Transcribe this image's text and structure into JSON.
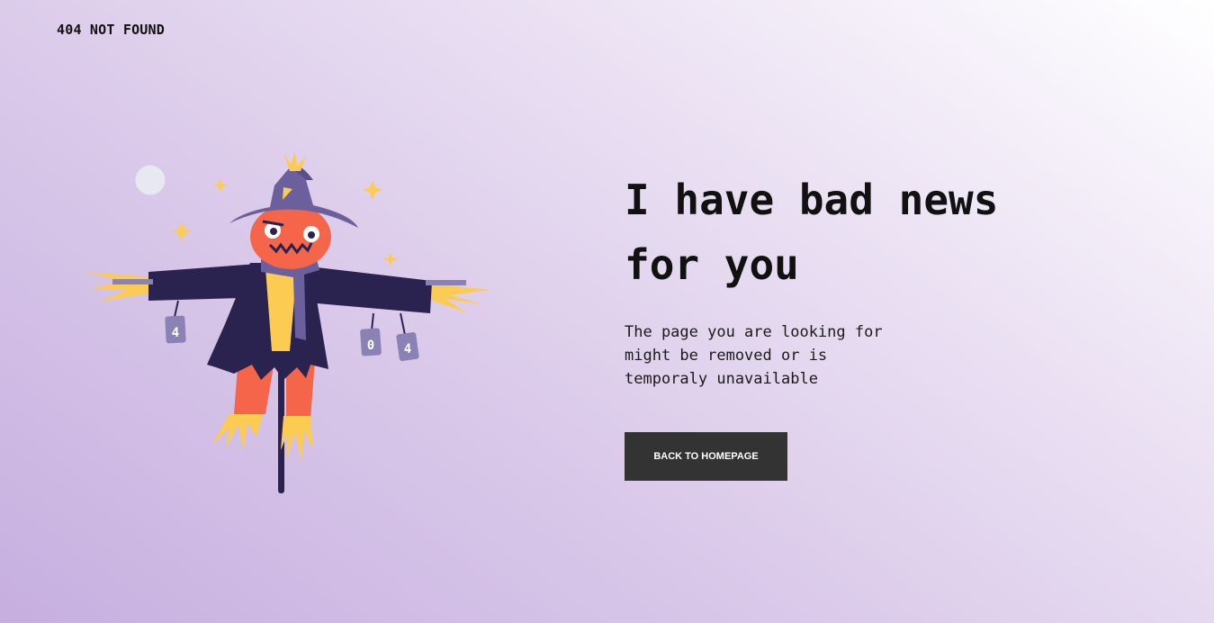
{
  "header": {
    "brand": "404 NOT FOUND"
  },
  "main": {
    "headline": "I have bad news for you",
    "description": "The page you are looking for might be removed or is temporaly unavailable",
    "button_label": "BACK TO HOMEPAGE"
  },
  "illustration": {
    "subject": "scarecrow",
    "can_labels": [
      "4",
      "0",
      "4"
    ]
  },
  "colors": {
    "background_start": "#c6afe0",
    "background_end": "#ffffff",
    "button_bg": "#333333",
    "button_text": "#ffffff",
    "coat": "#2a2350",
    "hat": "#6b5f9e",
    "face": "#f4654a",
    "straw": "#fccb52"
  }
}
